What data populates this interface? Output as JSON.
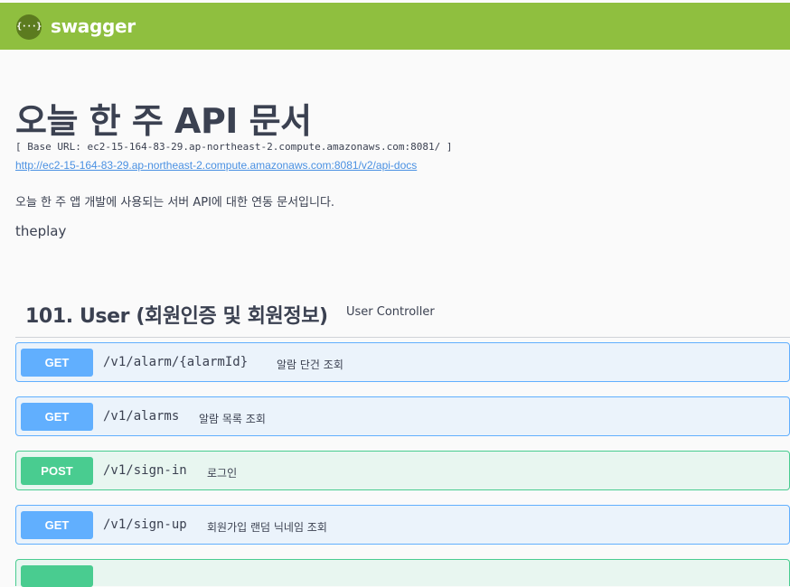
{
  "topbar": {
    "logo_text": "{···}",
    "brand": "swagger",
    "logo_icon": "swagger-logo-icon",
    "bg_color": "#8fbf3f"
  },
  "info": {
    "title": "오늘 한 주 API 문서",
    "base_url": "[ Base URL: ec2-15-164-83-29.ap-northeast-2.compute.amazonaws.com:8081/ ]",
    "docs_link": "http://ec2-15-164-83-29.ap-northeast-2.compute.amazonaws.com:8081/v2/api-docs",
    "description": "오늘 한 주 앱 개발에 사용되는 서버 API에 대한 연동 문서입니다.",
    "contact": "theplay"
  },
  "tag": {
    "name": "101. User (회원인증 및 회원정보)",
    "description": "User Controller"
  },
  "colors": {
    "get": "#61affe",
    "post": "#49cc90",
    "link": "#4990e2"
  },
  "operations": [
    {
      "method": "GET",
      "path": "/v1/alarm/{alarmId}",
      "summary": "알람 단건 조회"
    },
    {
      "method": "GET",
      "path": "/v1/alarms",
      "summary": "알람 목록 조회"
    },
    {
      "method": "POST",
      "path": "/v1/sign-in",
      "summary": "로그인"
    },
    {
      "method": "GET",
      "path": "/v1/sign-up",
      "summary": "회원가입 랜덤 닉네임 조회"
    }
  ]
}
